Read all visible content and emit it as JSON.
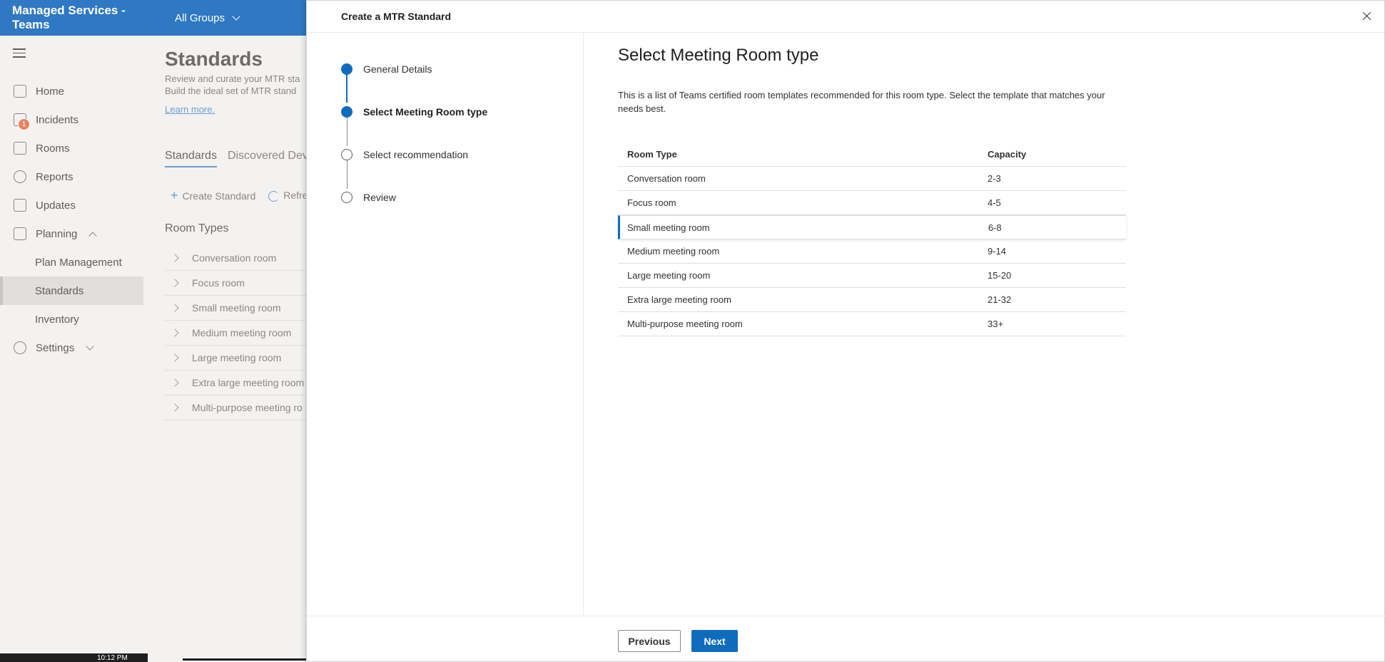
{
  "app": {
    "title": "Managed Services - Teams",
    "group_selector": "All Groups"
  },
  "nav": {
    "items": [
      {
        "label": "Home",
        "icon": "home-icon"
      },
      {
        "label": "Incidents",
        "icon": "incidents-icon",
        "badge": "1"
      },
      {
        "label": "Rooms",
        "icon": "rooms-icon"
      },
      {
        "label": "Reports",
        "icon": "reports-icon"
      },
      {
        "label": "Updates",
        "icon": "updates-icon"
      },
      {
        "label": "Planning",
        "icon": "planning-icon"
      },
      {
        "label": "Plan Management"
      },
      {
        "label": "Standards"
      },
      {
        "label": "Inventory"
      },
      {
        "label": "Settings",
        "icon": "gear-icon"
      }
    ]
  },
  "background_page": {
    "title": "Standards",
    "desc_line1": "Review and curate your MTR sta",
    "desc_line2": "Build the ideal set of MTR stand",
    "learn_more": "Learn more.",
    "tabs": [
      "Standards",
      "Discovered Dev"
    ],
    "create_standard": "Create Standard",
    "refresh": "Refre",
    "section_title": "Room Types",
    "room_types": [
      "Conversation room",
      "Focus room",
      "Small meeting room",
      "Medium meeting room",
      "Large meeting room",
      "Extra large meeting room",
      "Multi-purpose meeting ro"
    ]
  },
  "taskbar": {
    "time": "10:12 PM"
  },
  "panel": {
    "title": "Create a MTR Standard",
    "steps": [
      "General Details",
      "Select Meeting Room type",
      "Select recommendation",
      "Review"
    ],
    "heading": "Select Meeting Room type",
    "intro": "This is a list of Teams certified room templates recommended for this room type. Select the template that matches your needs best.",
    "table": {
      "headers": [
        "Room Type",
        "Capacity"
      ],
      "rows": [
        {
          "type": "Conversation room",
          "capacity": "2-3"
        },
        {
          "type": "Focus room",
          "capacity": "4-5"
        },
        {
          "type": "Small meeting room",
          "capacity": "6-8"
        },
        {
          "type": "Medium meeting room",
          "capacity": "9-14"
        },
        {
          "type": "Large meeting room",
          "capacity": "15-20"
        },
        {
          "type": "Extra large meeting room",
          "capacity": "21-32"
        },
        {
          "type": "Multi-purpose meeting room",
          "capacity": "33+"
        }
      ],
      "selected_row": "Small meeting room"
    },
    "previous_label": "Previous",
    "next_label": "Next"
  },
  "colors": {
    "topbar": "#2f78c4",
    "accent": "#0f6cbd",
    "badge": "#e9835f"
  }
}
